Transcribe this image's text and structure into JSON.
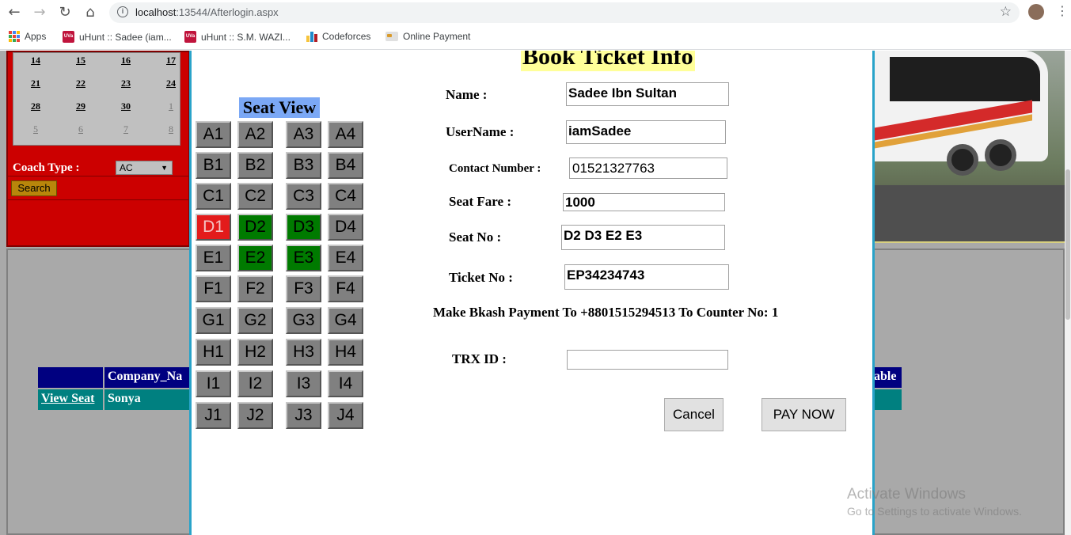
{
  "browser": {
    "url_host": "localhost",
    "url_rest": ":13544/Afterlogin.aspx",
    "bookmarks": [
      {
        "label": "Apps",
        "icon": "apps-grid-icon"
      },
      {
        "label": "uHunt :: Sadee (iam...",
        "icon": "uva-icon"
      },
      {
        "label": "uHunt :: S.M. WAZI...",
        "icon": "uva-icon"
      },
      {
        "label": "Codeforces",
        "icon": "codeforces-icon"
      },
      {
        "label": "Online Payment",
        "icon": "payment-icon"
      }
    ]
  },
  "calendar": {
    "rows": [
      [
        "14",
        "15",
        "16",
        "17"
      ],
      [
        "21",
        "22",
        "23",
        "24"
      ],
      [
        "28",
        "29",
        "30",
        "1"
      ],
      [
        "5",
        "6",
        "7",
        "8"
      ]
    ]
  },
  "search_panel": {
    "coach_type_label": "Coach Type :",
    "coach_type_value": "AC",
    "search_label": "Search"
  },
  "grid": {
    "header_company": "Company_Na",
    "header_right": "able",
    "row_link": "View Seat",
    "row_company": "Sonya"
  },
  "modal": {
    "title": "Book Ticket Info",
    "seat_view_title": "Seat View",
    "seats": [
      [
        {
          "id": "A1",
          "state": "available"
        },
        {
          "id": "A2",
          "state": "available"
        },
        {
          "id": "A3",
          "state": "available"
        },
        {
          "id": "A4",
          "state": "available"
        }
      ],
      [
        {
          "id": "B1",
          "state": "available"
        },
        {
          "id": "B2",
          "state": "available"
        },
        {
          "id": "B3",
          "state": "available"
        },
        {
          "id": "B4",
          "state": "available"
        }
      ],
      [
        {
          "id": "C1",
          "state": "available"
        },
        {
          "id": "C2",
          "state": "available"
        },
        {
          "id": "C3",
          "state": "available"
        },
        {
          "id": "C4",
          "state": "available"
        }
      ],
      [
        {
          "id": "D1",
          "state": "booked"
        },
        {
          "id": "D2",
          "state": "selected"
        },
        {
          "id": "D3",
          "state": "selected"
        },
        {
          "id": "D4",
          "state": "available"
        }
      ],
      [
        {
          "id": "E1",
          "state": "available"
        },
        {
          "id": "E2",
          "state": "selected"
        },
        {
          "id": "E3",
          "state": "selected"
        },
        {
          "id": "E4",
          "state": "available"
        }
      ],
      [
        {
          "id": "F1",
          "state": "available"
        },
        {
          "id": "F2",
          "state": "available"
        },
        {
          "id": "F3",
          "state": "available"
        },
        {
          "id": "F4",
          "state": "available"
        }
      ],
      [
        {
          "id": "G1",
          "state": "available"
        },
        {
          "id": "G2",
          "state": "available"
        },
        {
          "id": "G3",
          "state": "available"
        },
        {
          "id": "G4",
          "state": "available"
        }
      ],
      [
        {
          "id": "H1",
          "state": "available"
        },
        {
          "id": "H2",
          "state": "available"
        },
        {
          "id": "H3",
          "state": "available"
        },
        {
          "id": "H4",
          "state": "available"
        }
      ],
      [
        {
          "id": "I1",
          "state": "available"
        },
        {
          "id": "I2",
          "state": "available"
        },
        {
          "id": "I3",
          "state": "available"
        },
        {
          "id": "I4",
          "state": "available"
        }
      ],
      [
        {
          "id": "J1",
          "state": "available"
        },
        {
          "id": "J2",
          "state": "available"
        },
        {
          "id": "J3",
          "state": "available"
        },
        {
          "id": "J4",
          "state": "available"
        }
      ]
    ],
    "seat_colors": {
      "available": "#808080",
      "booked": "#e31b1b",
      "selected": "#007a00"
    },
    "fields": {
      "name_label": "Name :",
      "name_value": "Sadee Ibn Sultan",
      "username_label": "UserName :",
      "username_value": "iamSadee",
      "contact_label": "Contact Number :",
      "contact_value": "01521327763",
      "fare_label": "Seat Fare :",
      "fare_value": "1000",
      "seatno_label": "Seat No :",
      "seatno_value": "D2 D3 E2 E3",
      "ticket_label": "Ticket No :",
      "ticket_value": "EP34234743",
      "trx_label": "TRX ID :",
      "trx_value": ""
    },
    "payment_note": "Make Bkash Payment To +8801515294513 To Counter No: 1",
    "cancel_label": "Cancel",
    "pay_label": "PAY NOW"
  },
  "watermark": {
    "line1": "Activate Windows",
    "line2": "Go to Settings to activate Windows."
  }
}
